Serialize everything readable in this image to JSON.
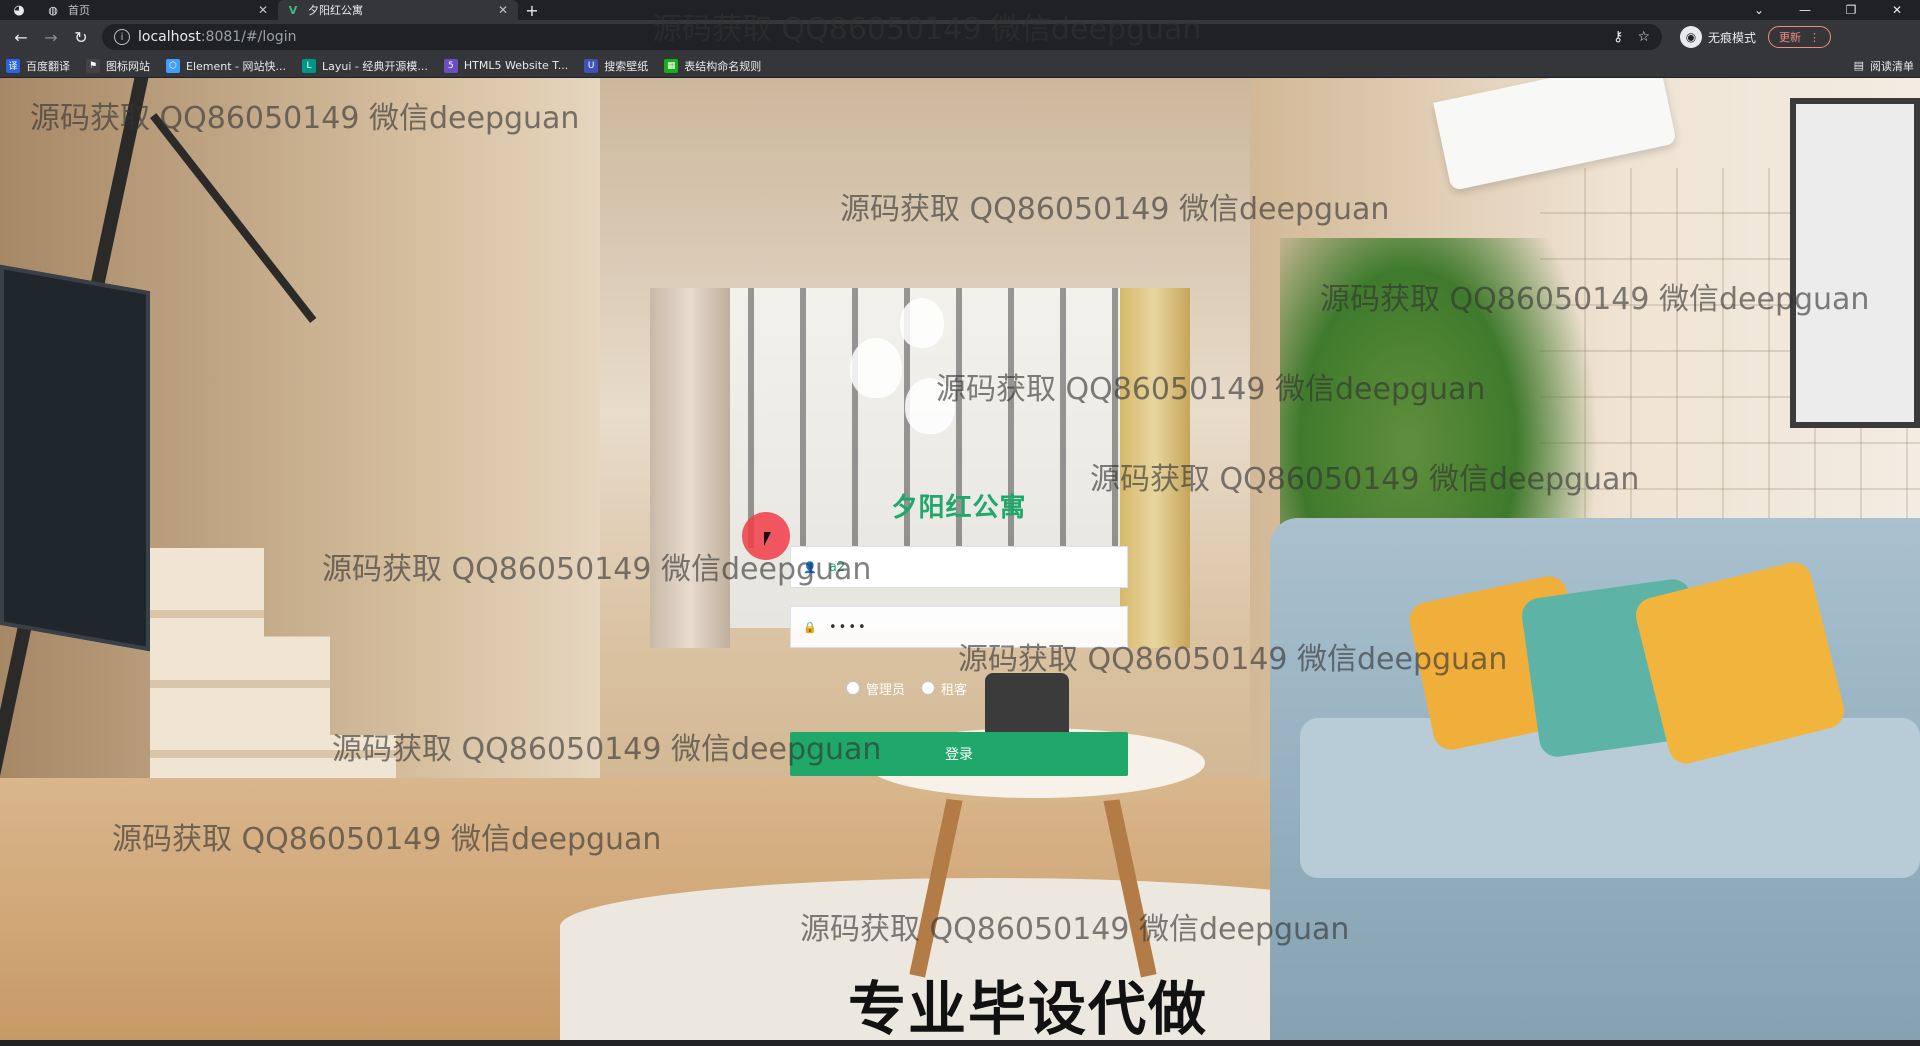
{
  "browser": {
    "tabs": [
      {
        "title": "首页",
        "active": false
      },
      {
        "title": "夕阳红公寓",
        "active": true
      }
    ],
    "url_host": "localhost",
    "url_path": ":8081/#/login",
    "incognito_label": "无痕模式",
    "update_label": "更新",
    "bookmarks": [
      {
        "label": "百度翻译",
        "color": "#2b64e3"
      },
      {
        "label": "图标网站",
        "color": "#444444"
      },
      {
        "label": "Element - 网站快...",
        "color": "#409eff"
      },
      {
        "label": "Layui - 经典开源模...",
        "color": "#009688"
      },
      {
        "label": "HTML5 Website T...",
        "color": "#6c4dc4"
      },
      {
        "label": "搜索壁纸",
        "color": "#3f51b5"
      },
      {
        "label": "表结构命名规则",
        "color": "#1aad19"
      }
    ],
    "reading_list_label": "阅读清单"
  },
  "login": {
    "title": "夕阳红公寓",
    "username_value": "a2",
    "password_value": "••••",
    "roles": [
      "管理员",
      "租客"
    ],
    "submit_label": "登录",
    "accent_color": "#1fa86a"
  },
  "overlay": {
    "watermark_text": "源码获取 QQ86050149 微信deepguan",
    "banner_text": "专业毕设代做"
  }
}
